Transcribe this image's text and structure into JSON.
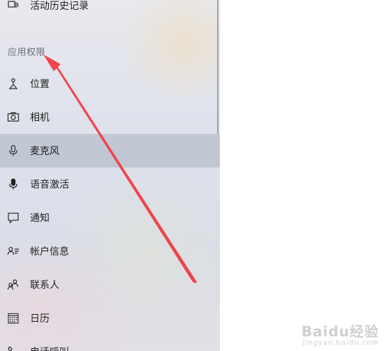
{
  "sidebar": {
    "top_item": {
      "label": "活动历史记录",
      "icon": "activity-history-icon"
    },
    "section_header": "应用权限",
    "items": [
      {
        "label": "位置",
        "icon": "location-icon"
      },
      {
        "label": "相机",
        "icon": "camera-icon"
      },
      {
        "label": "麦克风",
        "icon": "microphone-icon",
        "selected": true
      },
      {
        "label": "语音激活",
        "icon": "voice-activation-icon"
      },
      {
        "label": "通知",
        "icon": "notification-icon"
      },
      {
        "label": "帐户信息",
        "icon": "account-info-icon"
      },
      {
        "label": "联系人",
        "icon": "contacts-icon"
      },
      {
        "label": "日历",
        "icon": "calendar-icon"
      },
      {
        "label": "电话呼叫",
        "icon": "phone-call-icon"
      }
    ]
  },
  "annotation": {
    "arrow_color": "#f0444e"
  },
  "watermark": {
    "logo": "Baidu经验",
    "sub": "jingyan.baidu.com"
  }
}
